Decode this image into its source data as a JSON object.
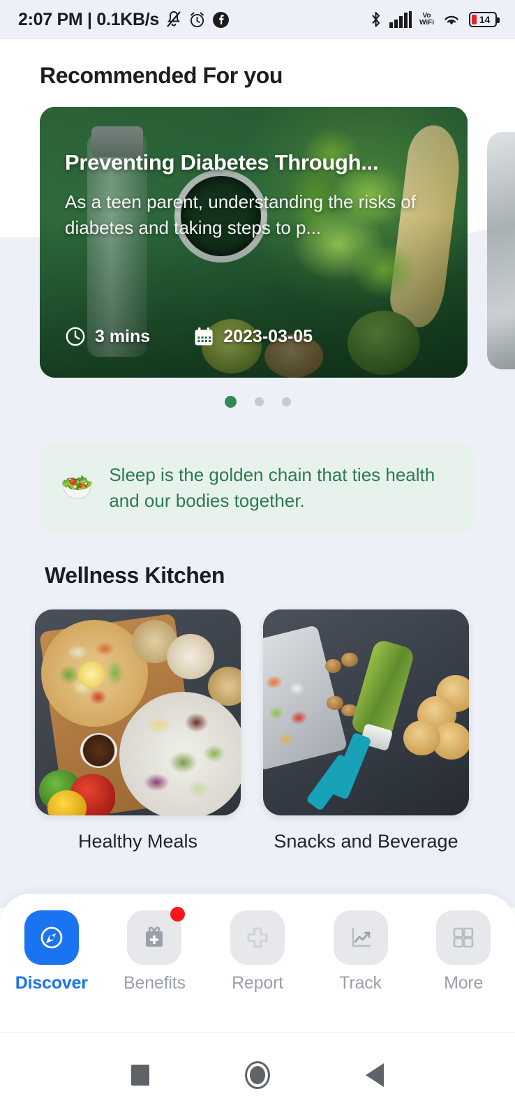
{
  "status_bar": {
    "time": "2:07 PM",
    "separator": "|",
    "network_speed": "0.1KB/s",
    "icons_left": [
      "mute-bell-icon",
      "alarm-clock-icon",
      "facebook-icon"
    ],
    "icons_right": [
      "bluetooth-icon",
      "signal-bars-icon",
      "vowifi-icon",
      "wifi-icon",
      "battery-icon"
    ],
    "vowifi_top": "Vo",
    "vowifi_bottom": "WiFi",
    "battery_level": "14"
  },
  "recommended": {
    "section_title": "Recommended For you",
    "card": {
      "title": "Preventing Diabetes Through...",
      "description": "As a teen parent, understanding the risks of diabetes and taking steps to p...",
      "read_time": "3 mins",
      "date": "2023-03-05",
      "clock_icon": "clock-icon",
      "calendar_icon": "calendar-icon"
    },
    "dots": [
      {
        "active": true
      },
      {
        "active": false
      },
      {
        "active": false
      }
    ]
  },
  "quote": {
    "icon": "salad-bowl-icon",
    "emoji": "🥗",
    "text": "Sleep is the golden chain that ties health and our bodies together."
  },
  "wellness_kitchen": {
    "section_title": "Wellness Kitchen",
    "items": [
      {
        "label": "Healthy Meals",
        "image": "healthy-meals-photo"
      },
      {
        "label": "Snacks and Beverage",
        "image": "snacks-beverage-photo"
      }
    ]
  },
  "bottom_nav": {
    "items": [
      {
        "label": "Discover",
        "icon": "compass-icon",
        "active": true,
        "badge": false
      },
      {
        "label": "Benefits",
        "icon": "gift-icon",
        "active": false,
        "badge": true
      },
      {
        "label": "Report",
        "icon": "medical-cross-icon",
        "active": false,
        "badge": false
      },
      {
        "label": "Track",
        "icon": "chart-trend-icon",
        "active": false,
        "badge": false
      },
      {
        "label": "More",
        "icon": "grid-icon",
        "active": false,
        "badge": false
      }
    ]
  },
  "system_nav": {
    "recents": "recents-square-icon",
    "home": "home-circle-icon",
    "back": "back-triangle-icon"
  },
  "colors": {
    "accent_blue": "#1a73f0",
    "accent_green": "#2e8b57",
    "quote_green": "#2c7a52",
    "quote_bg": "#e8f2ec",
    "page_bg": "#eef0f8",
    "badge_red": "#ff1515",
    "hero_green": "#2d6b3d"
  }
}
